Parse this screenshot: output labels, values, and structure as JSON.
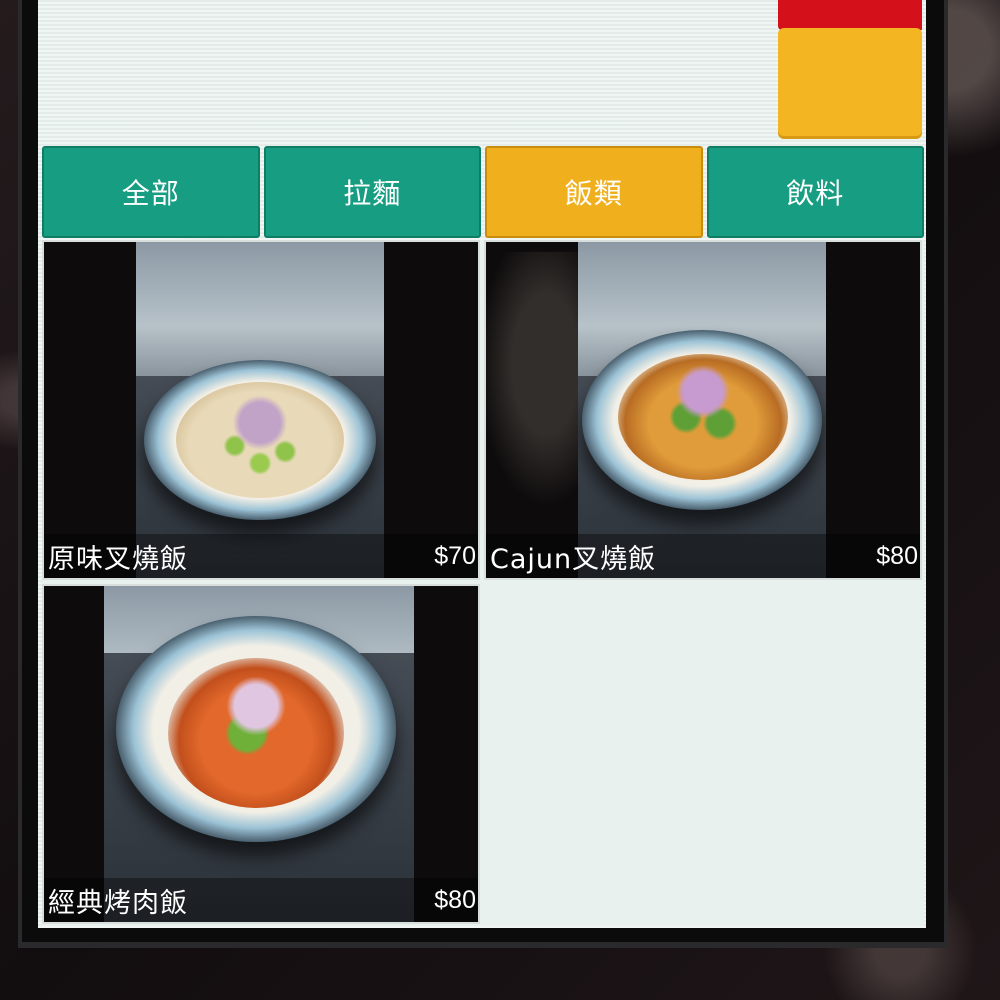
{
  "tabs": [
    {
      "label": "全部",
      "active": false
    },
    {
      "label": "拉麵",
      "active": false
    },
    {
      "label": "飯類",
      "active": true
    },
    {
      "label": "飲料",
      "active": false
    }
  ],
  "menu_items": [
    {
      "name": "原味叉燒飯",
      "price": "$70",
      "photo": "rice-bowl-plain-chashu"
    },
    {
      "name": "Cajun叉燒飯",
      "price": "$80",
      "photo": "rice-bowl-cajun-chashu"
    },
    {
      "name": "經典烤肉飯",
      "price": "$80",
      "photo": "rice-bowl-bbq-pork"
    }
  ],
  "colors": {
    "tab_default": "#179e82",
    "tab_active": "#f0b01e",
    "accent_red": "#d4101a",
    "accent_yellow": "#f3b521"
  }
}
